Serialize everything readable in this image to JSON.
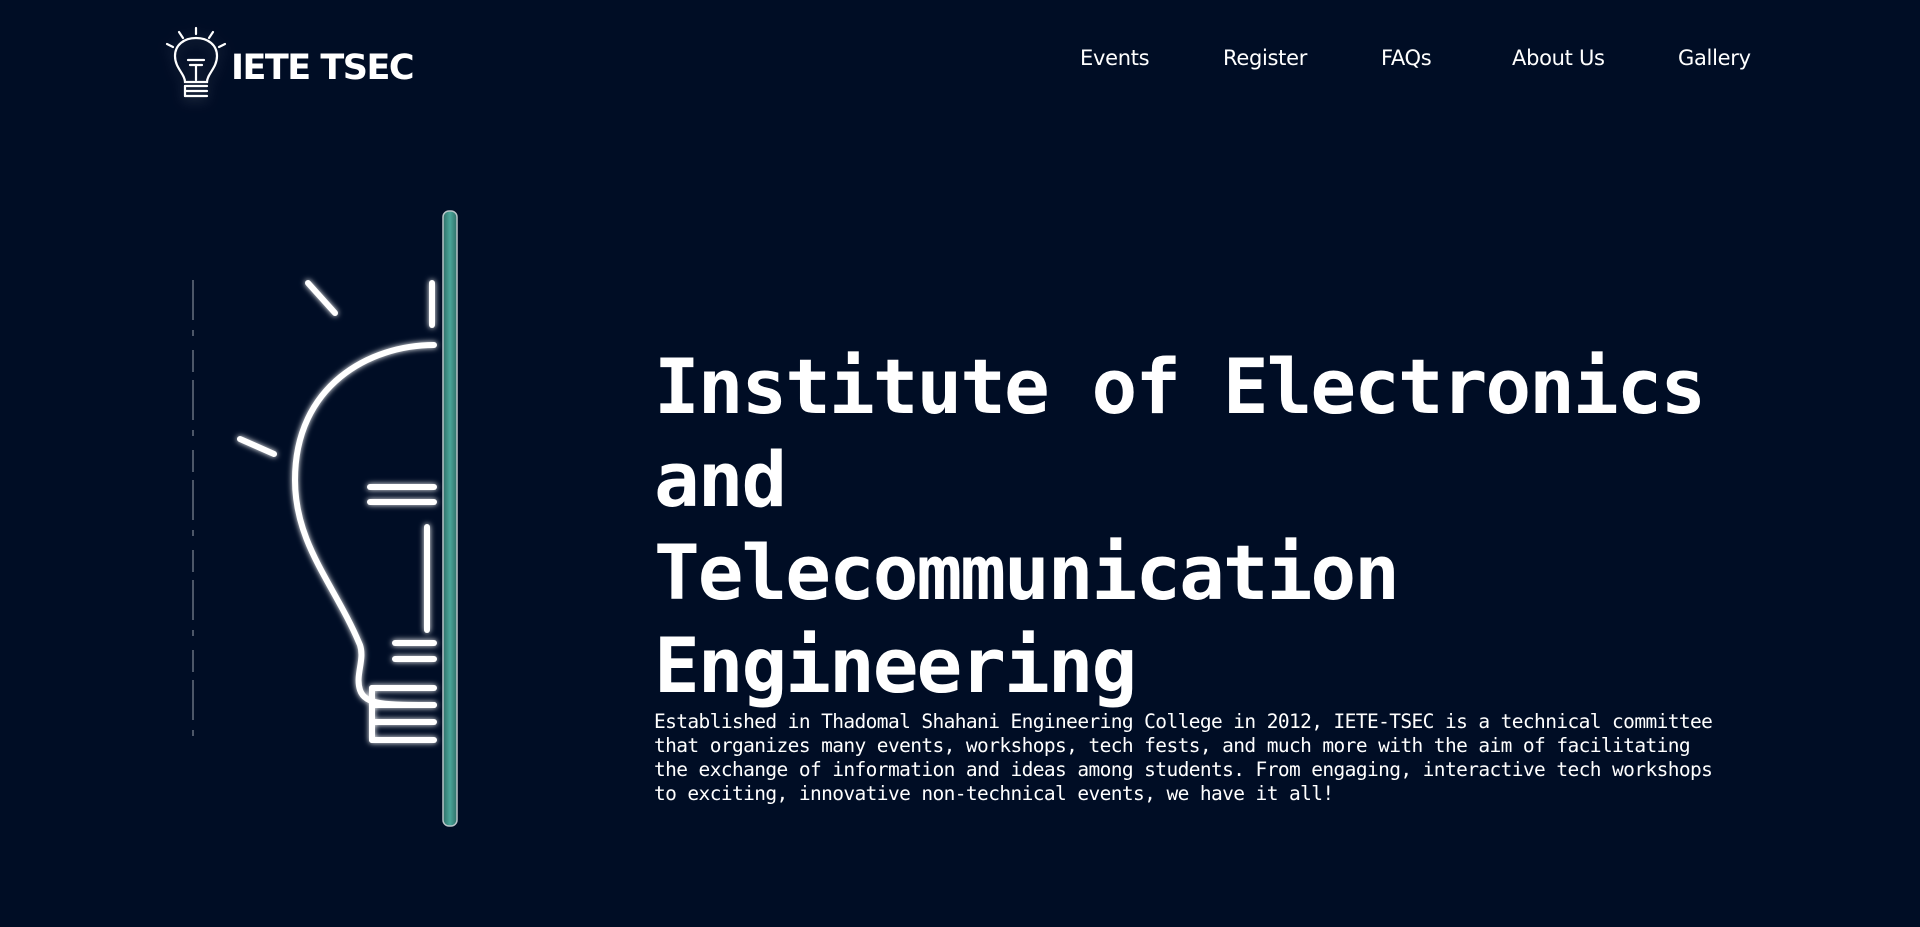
{
  "header": {
    "logo_text": "IETE TSEC",
    "nav": [
      {
        "label": "Events"
      },
      {
        "label": "Register"
      },
      {
        "label": "FAQs"
      },
      {
        "label": "About Us"
      },
      {
        "label": "Gallery"
      }
    ]
  },
  "hero": {
    "title_lines": [
      "Institute of Electronics and",
      "Telecommunication",
      "Engineering"
    ],
    "description": "Established in Thadomal Shahani Engineering College in 2012, IETE-TSEC is a technical committee that organizes many events, workshops, tech fests, and much more with the aim of facilitating the exchange of information and ideas among students. From engaging, interactive tech workshops to exciting, innovative non-technical events, we have it all!"
  },
  "colors": {
    "background": "#000d25",
    "text": "#ffffff",
    "accent_bar": "#3f8f86"
  },
  "icons": {
    "logo": "lightbulb-icon",
    "hero": "half-lightbulb-icon"
  }
}
